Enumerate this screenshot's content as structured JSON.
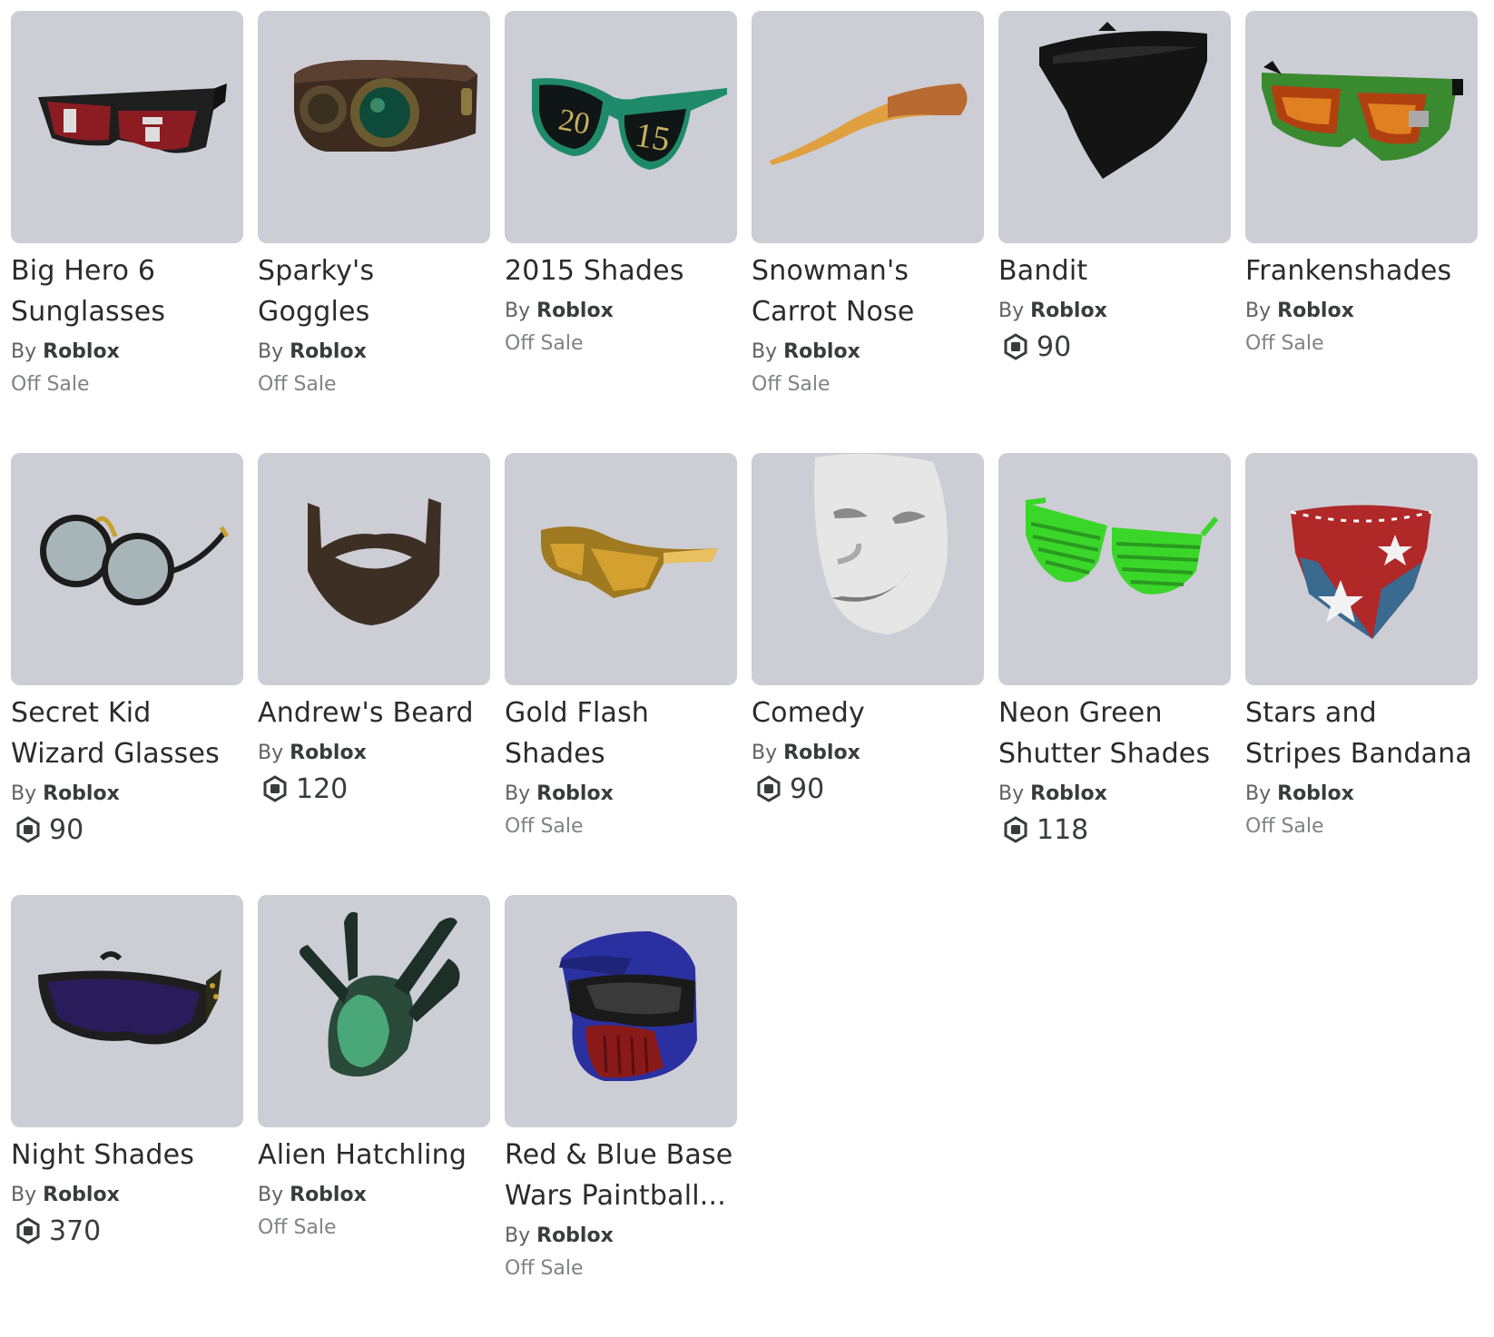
{
  "items": [
    {
      "name": "Big Hero 6 Sunglasses",
      "by": "By",
      "creator": "Roblox",
      "status": "Off Sale",
      "price": null,
      "thumb": "big-hero-6-sunglasses-icon"
    },
    {
      "name": "Sparky's Goggles",
      "by": "By",
      "creator": "Roblox",
      "status": "Off Sale",
      "price": null,
      "thumb": "sparkys-goggles-icon"
    },
    {
      "name": "2015 Shades",
      "by": "By",
      "creator": "Roblox",
      "status": "Off Sale",
      "price": null,
      "thumb": "2015-shades-icon"
    },
    {
      "name": "Snowman's Carrot Nose",
      "by": "By",
      "creator": "Roblox",
      "status": "Off Sale",
      "price": null,
      "thumb": "carrot-nose-icon"
    },
    {
      "name": "Bandit",
      "by": "By",
      "creator": "Roblox",
      "status": null,
      "price": "90",
      "thumb": "bandit-icon"
    },
    {
      "name": "Frankenshades",
      "by": "By",
      "creator": "Roblox",
      "status": "Off Sale",
      "price": null,
      "thumb": "frankenshades-icon"
    },
    {
      "name": "Secret Kid Wizard Glasses",
      "by": "By",
      "creator": "Roblox",
      "status": null,
      "price": "90",
      "thumb": "round-glasses-icon"
    },
    {
      "name": "Andrew's Beard",
      "by": "By",
      "creator": "Roblox",
      "status": null,
      "price": "120",
      "thumb": "beard-icon"
    },
    {
      "name": "Gold Flash Shades",
      "by": "By",
      "creator": "Roblox",
      "status": "Off Sale",
      "price": null,
      "thumb": "gold-shades-icon"
    },
    {
      "name": "Comedy",
      "by": "By",
      "creator": "Roblox",
      "status": null,
      "price": "90",
      "thumb": "comedy-mask-icon"
    },
    {
      "name": "Neon Green Shutter Shades",
      "by": "By",
      "creator": "Roblox",
      "status": null,
      "price": "118",
      "thumb": "shutter-shades-icon"
    },
    {
      "name": "Stars and Stripes Bandana",
      "by": "By",
      "creator": "Roblox",
      "status": "Off Sale",
      "price": null,
      "thumb": "stars-bandana-icon"
    },
    {
      "name": "Night Shades",
      "by": "By",
      "creator": "Roblox",
      "status": null,
      "price": "370",
      "thumb": "night-shades-icon"
    },
    {
      "name": "Alien Hatchling",
      "by": "By",
      "creator": "Roblox",
      "status": "Off Sale",
      "price": null,
      "thumb": "alien-hatchling-icon"
    },
    {
      "name": "Red & Blue Base Wars Paintball...",
      "by": "By",
      "creator": "Roblox",
      "status": "Off Sale",
      "price": null,
      "thumb": "paintball-helmet-icon"
    }
  ],
  "icons": {
    "currency": "robux-icon"
  },
  "colors": {
    "thumb_bg": "#cdcdd5",
    "text": "#2b2b2e",
    "muted": "#808284"
  }
}
